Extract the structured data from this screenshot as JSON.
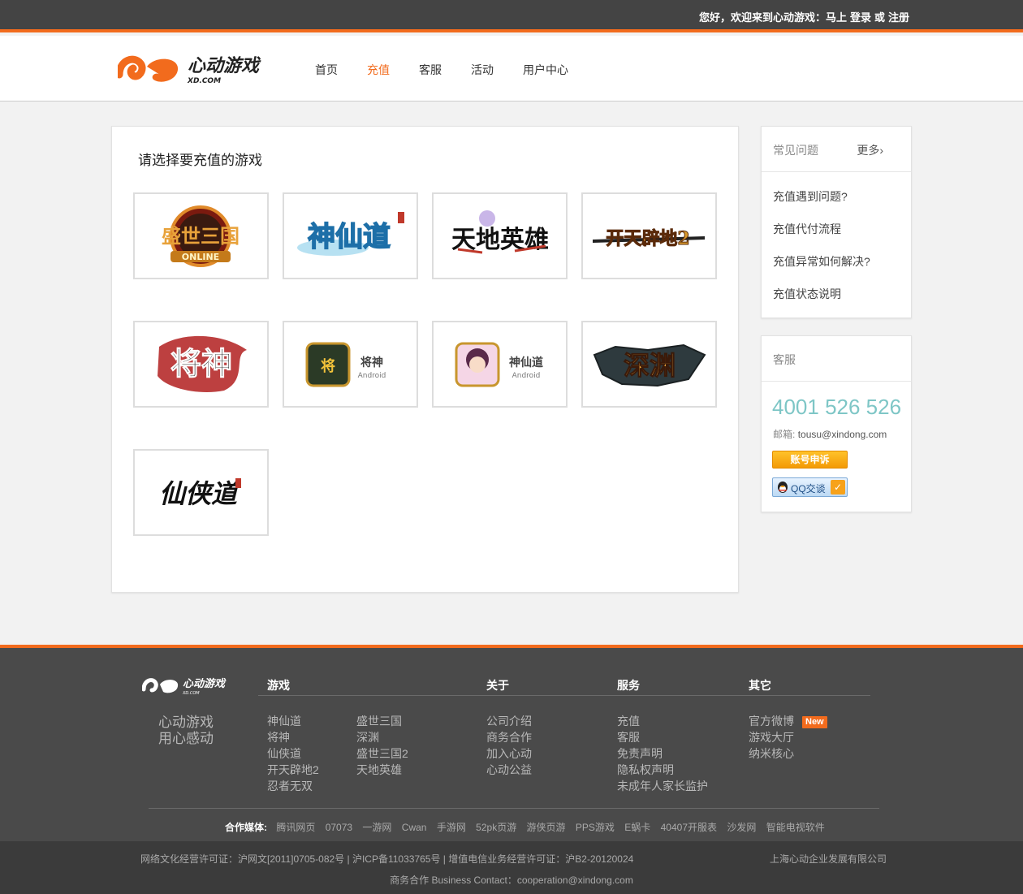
{
  "topbar": {
    "greeting": "您好，欢迎来到心动游戏：马上",
    "login": "登录",
    "or": "或",
    "register": "注册"
  },
  "header": {
    "logo_text": "心动游戏",
    "logo_sub": "XD.COM",
    "nav": [
      "首页",
      "充值",
      "客服",
      "活动",
      "用户中心"
    ],
    "active_nav": "充值"
  },
  "main": {
    "title": "请选择要充值的游戏",
    "games": [
      {
        "logo_text": "盛世三国",
        "sub": "ONLINE"
      },
      {
        "logo_text": "神仙道",
        "sub": ""
      },
      {
        "logo_text": "天地英雄",
        "sub": ""
      },
      {
        "logo_text": "开天辟地2",
        "sub": ""
      },
      {
        "logo_text": "将神",
        "sub": ""
      },
      {
        "logo_text": "将神",
        "sub": "Android"
      },
      {
        "logo_text": "神仙道",
        "sub": "Android"
      },
      {
        "logo_text": "深渊",
        "sub": ""
      },
      {
        "logo_text": "仙侠道",
        "sub": ""
      }
    ]
  },
  "faq": {
    "title": "常见问题",
    "more": "更多›",
    "items": [
      "充值遇到问题?",
      "充值代付流程",
      "充值异常如何解决?",
      "充值状态说明"
    ]
  },
  "service": {
    "title": "客服",
    "phone": "4001 526 526",
    "email_label": "邮箱:",
    "email": "tousu@xindong.com",
    "appeal_button": "账号申诉",
    "qq_button": "QQ交谈"
  },
  "footer": {
    "logo_text": "心动游戏",
    "logo_sub": "XD.COM",
    "slogan": [
      "心动游戏",
      "用心感动"
    ],
    "columns": {
      "games": {
        "title": "游戏",
        "col1": [
          "神仙道",
          "将神",
          "仙侠道",
          "开天辟地2",
          "忍者无双"
        ],
        "col2": [
          "盛世三国",
          "深渊",
          "盛世三国2",
          "天地英雄"
        ]
      },
      "about": {
        "title": "关于",
        "items": [
          "公司介绍",
          "商务合作",
          "加入心动",
          "心动公益"
        ]
      },
      "service": {
        "title": "服务",
        "items": [
          "充值",
          "客服",
          "免责声明",
          "隐私权声明",
          "未成年人家长监护"
        ]
      },
      "other": {
        "title": "其它",
        "items": [
          "官方微博",
          "游戏大厅",
          "纳米核心"
        ],
        "new_badge": "New"
      }
    },
    "partners_label": "合作媒体:",
    "partners": [
      "腾讯网页",
      "07073",
      "一游网",
      "Cwan",
      "手游网",
      "52pk页游",
      "游侠页游",
      "PPS游戏",
      "E蜗卡",
      "40407开服表",
      "沙发网",
      "智能电视软件"
    ],
    "license": "网络文化经营许可证：沪网文[2011]0705-082号 | 沪ICP备11033765号 | 增值电信业务经营许可证：沪B2-20120024",
    "company": "上海心动企业发展有限公司",
    "contact": "商务合作 Business Contact：cooperation@xindong.com"
  },
  "colors": {
    "accent": "#f26b1d",
    "topbar": "#444444",
    "footer": "#4a4a4a",
    "phone": "#7ec6c6"
  }
}
